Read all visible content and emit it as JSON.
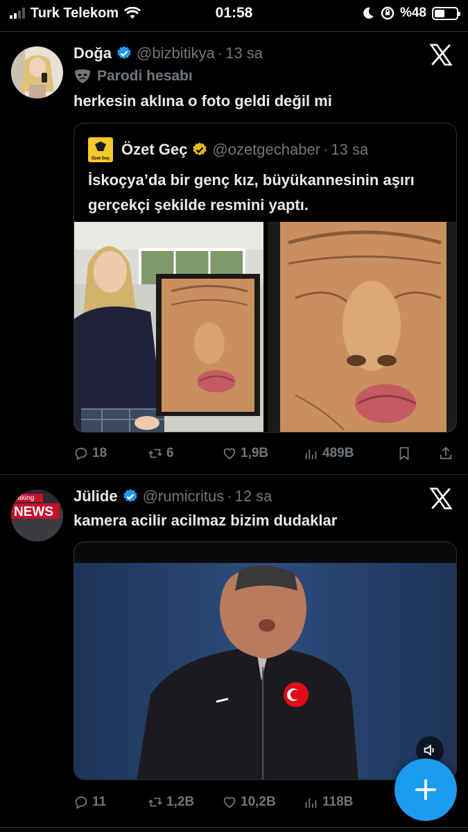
{
  "status_bar": {
    "carrier": "Turk Telekom",
    "time": "01:58",
    "battery_text": "%48",
    "battery_level": 0.48
  },
  "tweets": [
    {
      "name": "Doğa",
      "handle": "@bizbitikya",
      "time": "13 sa",
      "label": "Parodi hesabı",
      "text": "herkesin aklına o foto geldi değil mi",
      "quote": {
        "logo_text": "Özet Geç",
        "name": "Özet Geç",
        "handle": "@ozetgechaber",
        "time": "13 sa",
        "text": "İskoçya’da bir genç kız, büyükannesinin aşırı gerçekçi şekilde resmini yaptı."
      },
      "stats": {
        "replies": "18",
        "retweets": "6",
        "likes": "1,9B",
        "views": "489B"
      }
    },
    {
      "name": "Jülide",
      "handle": "@rumicritus",
      "time": "12 sa",
      "avatar_badge_top": "eaking",
      "avatar_badge": "NEWS",
      "text": "kamera acilir acilmaz bizim dudaklar",
      "stats": {
        "replies": "11",
        "retweets": "1,2B",
        "likes": "10,2B",
        "views": "118B"
      }
    }
  ],
  "colors": {
    "background": "#000000",
    "text": "#e7e9ea",
    "muted": "#71767b",
    "accent": "#1d9bf0",
    "border": "#2f3336",
    "gold": "#f6c82e"
  },
  "icons": [
    "x-logo-icon",
    "verified-icon",
    "gold-verified-icon",
    "parody-mask-icon",
    "reply-icon",
    "retweet-icon",
    "like-icon",
    "views-icon",
    "bookmark-icon",
    "share-icon",
    "compose-plus-icon",
    "volume-icon",
    "wifi-icon",
    "moon-icon",
    "rotation-lock-icon"
  ]
}
